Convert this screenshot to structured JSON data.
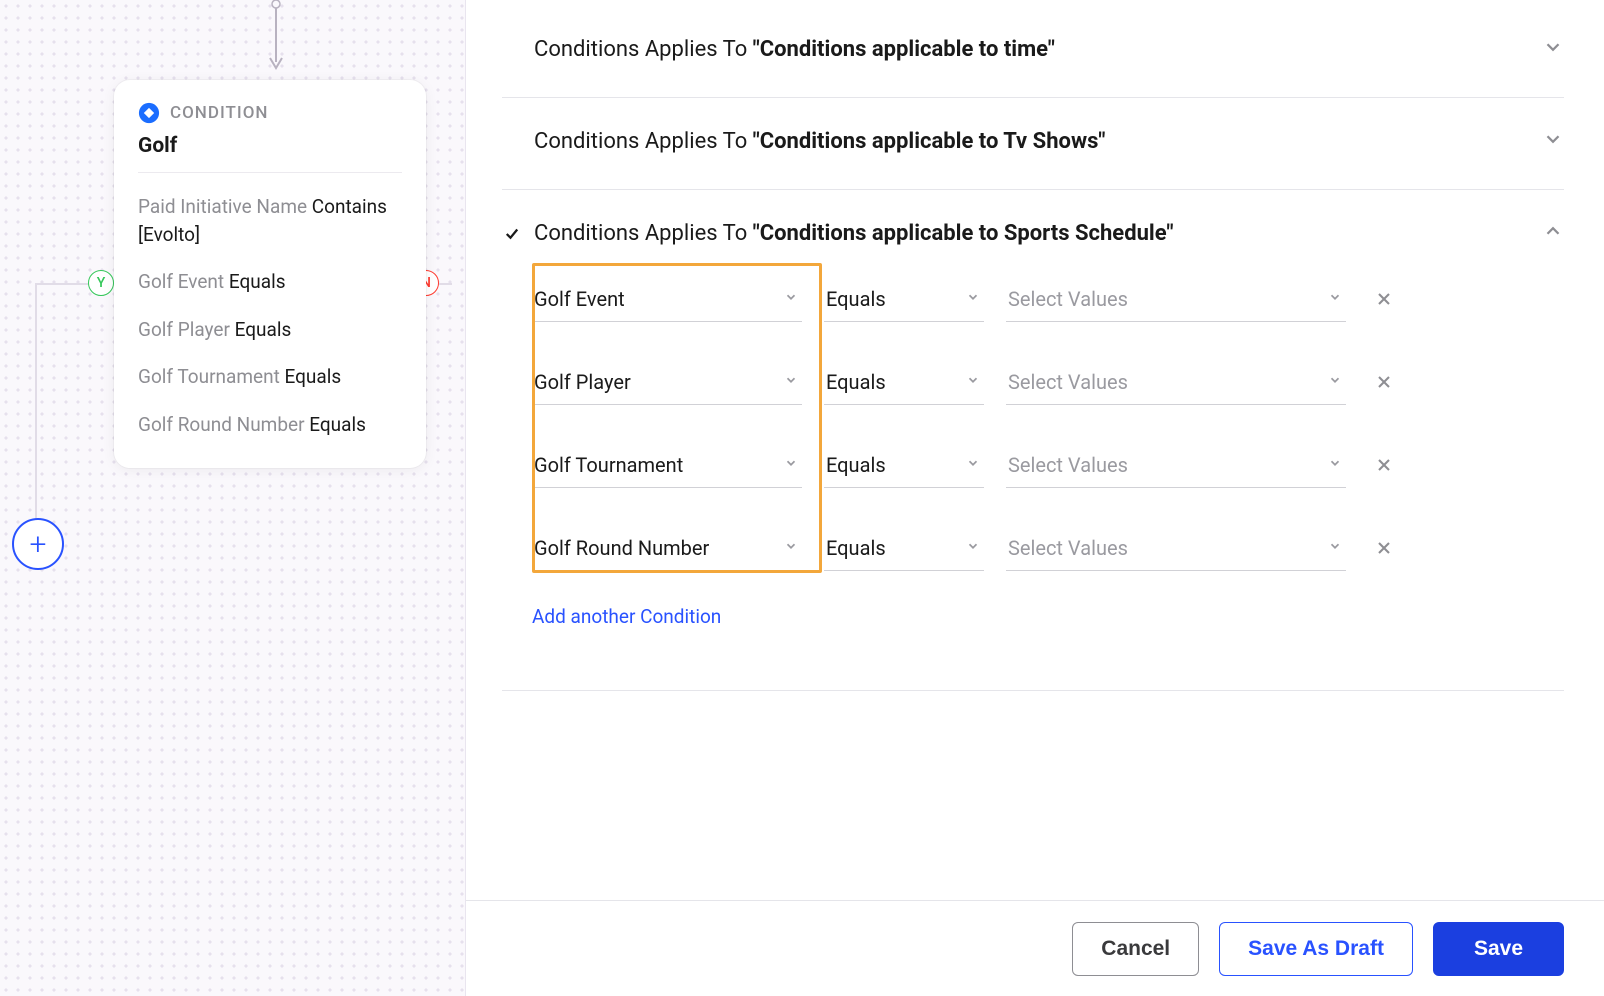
{
  "canvas": {
    "yes_label": "Y",
    "no_label": "N",
    "add_label": "+"
  },
  "card": {
    "type_label": "CONDITION",
    "title": "Golf",
    "rules": [
      {
        "attr": "Paid Initiative Name",
        "op": "Contains",
        "val": "[Evolto]"
      },
      {
        "attr": "Golf Event",
        "op": "Equals",
        "val": ""
      },
      {
        "attr": "Golf Player",
        "op": "Equals",
        "val": ""
      },
      {
        "attr": "Golf Tournament",
        "op": "Equals",
        "val": ""
      },
      {
        "attr": "Golf Round Number",
        "op": "Equals",
        "val": ""
      }
    ]
  },
  "panel": {
    "applies_prefix": "Conditions Applies To",
    "sections": [
      {
        "quoted": "\"Conditions applicable to time\"",
        "expanded": false,
        "checked": false
      },
      {
        "quoted": "\"Conditions applicable to Tv Shows\"",
        "expanded": false,
        "checked": false
      },
      {
        "quoted": "\"Conditions applicable to Sports Schedule\"",
        "expanded": true,
        "checked": true
      }
    ],
    "value_placeholder": "Select Values",
    "rows": [
      {
        "attr": "Golf Event",
        "op": "Equals"
      },
      {
        "attr": "Golf Player",
        "op": "Equals"
      },
      {
        "attr": "Golf Tournament",
        "op": "Equals"
      },
      {
        "attr": "Golf Round Number",
        "op": "Equals"
      }
    ],
    "add_link": "Add another Condition"
  },
  "footer": {
    "cancel": "Cancel",
    "draft": "Save As Draft",
    "save": "Save"
  }
}
